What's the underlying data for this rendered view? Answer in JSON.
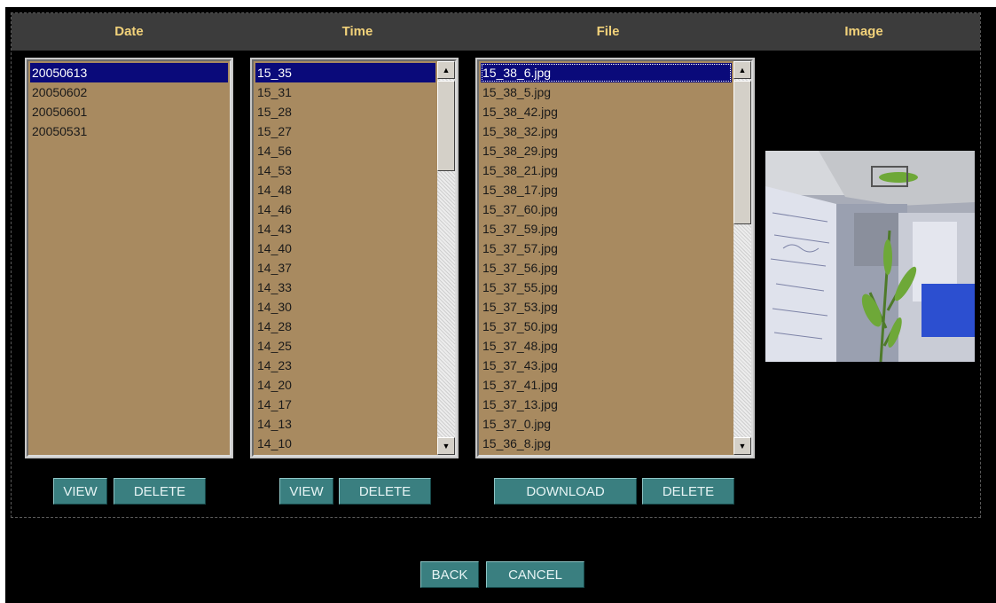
{
  "header": {
    "date": "Date",
    "time": "Time",
    "file": "File",
    "image": "Image"
  },
  "date_list": {
    "items": [
      "20050613",
      "20050602",
      "20050601",
      "20050531"
    ],
    "selected": 0
  },
  "time_list": {
    "items": [
      "15_35",
      "15_31",
      "15_28",
      "15_27",
      "14_56",
      "14_53",
      "14_48",
      "14_46",
      "14_43",
      "14_40",
      "14_37",
      "14_33",
      "14_30",
      "14_28",
      "14_25",
      "14_23",
      "14_20",
      "14_17",
      "14_13",
      "14_10"
    ],
    "selected": 0
  },
  "file_list": {
    "items": [
      "15_38_6.jpg",
      "15_38_5.jpg",
      "15_38_42.jpg",
      "15_38_32.jpg",
      "15_38_29.jpg",
      "15_38_21.jpg",
      "15_38_17.jpg",
      "15_37_60.jpg",
      "15_37_59.jpg",
      "15_37_57.jpg",
      "15_37_56.jpg",
      "15_37_55.jpg",
      "15_37_53.jpg",
      "15_37_50.jpg",
      "15_37_48.jpg",
      "15_37_43.jpg",
      "15_37_41.jpg",
      "15_37_13.jpg",
      "15_37_0.jpg",
      "15_36_8.jpg"
    ],
    "selected": 0
  },
  "buttons": {
    "date_view": "VIEW",
    "date_delete": "DELETE",
    "time_view": "VIEW",
    "time_delete": "DELETE",
    "file_download": "DOWNLOAD",
    "file_delete": "DELETE",
    "back": "BACK",
    "cancel": "CANCEL"
  },
  "colors": {
    "background": "#000000",
    "header_bg": "#3c3c3c",
    "header_text": "#f2d27a",
    "list_bg": "#a88a60",
    "selection": "#0a0a7a",
    "button_bg": "#3a7f80"
  }
}
